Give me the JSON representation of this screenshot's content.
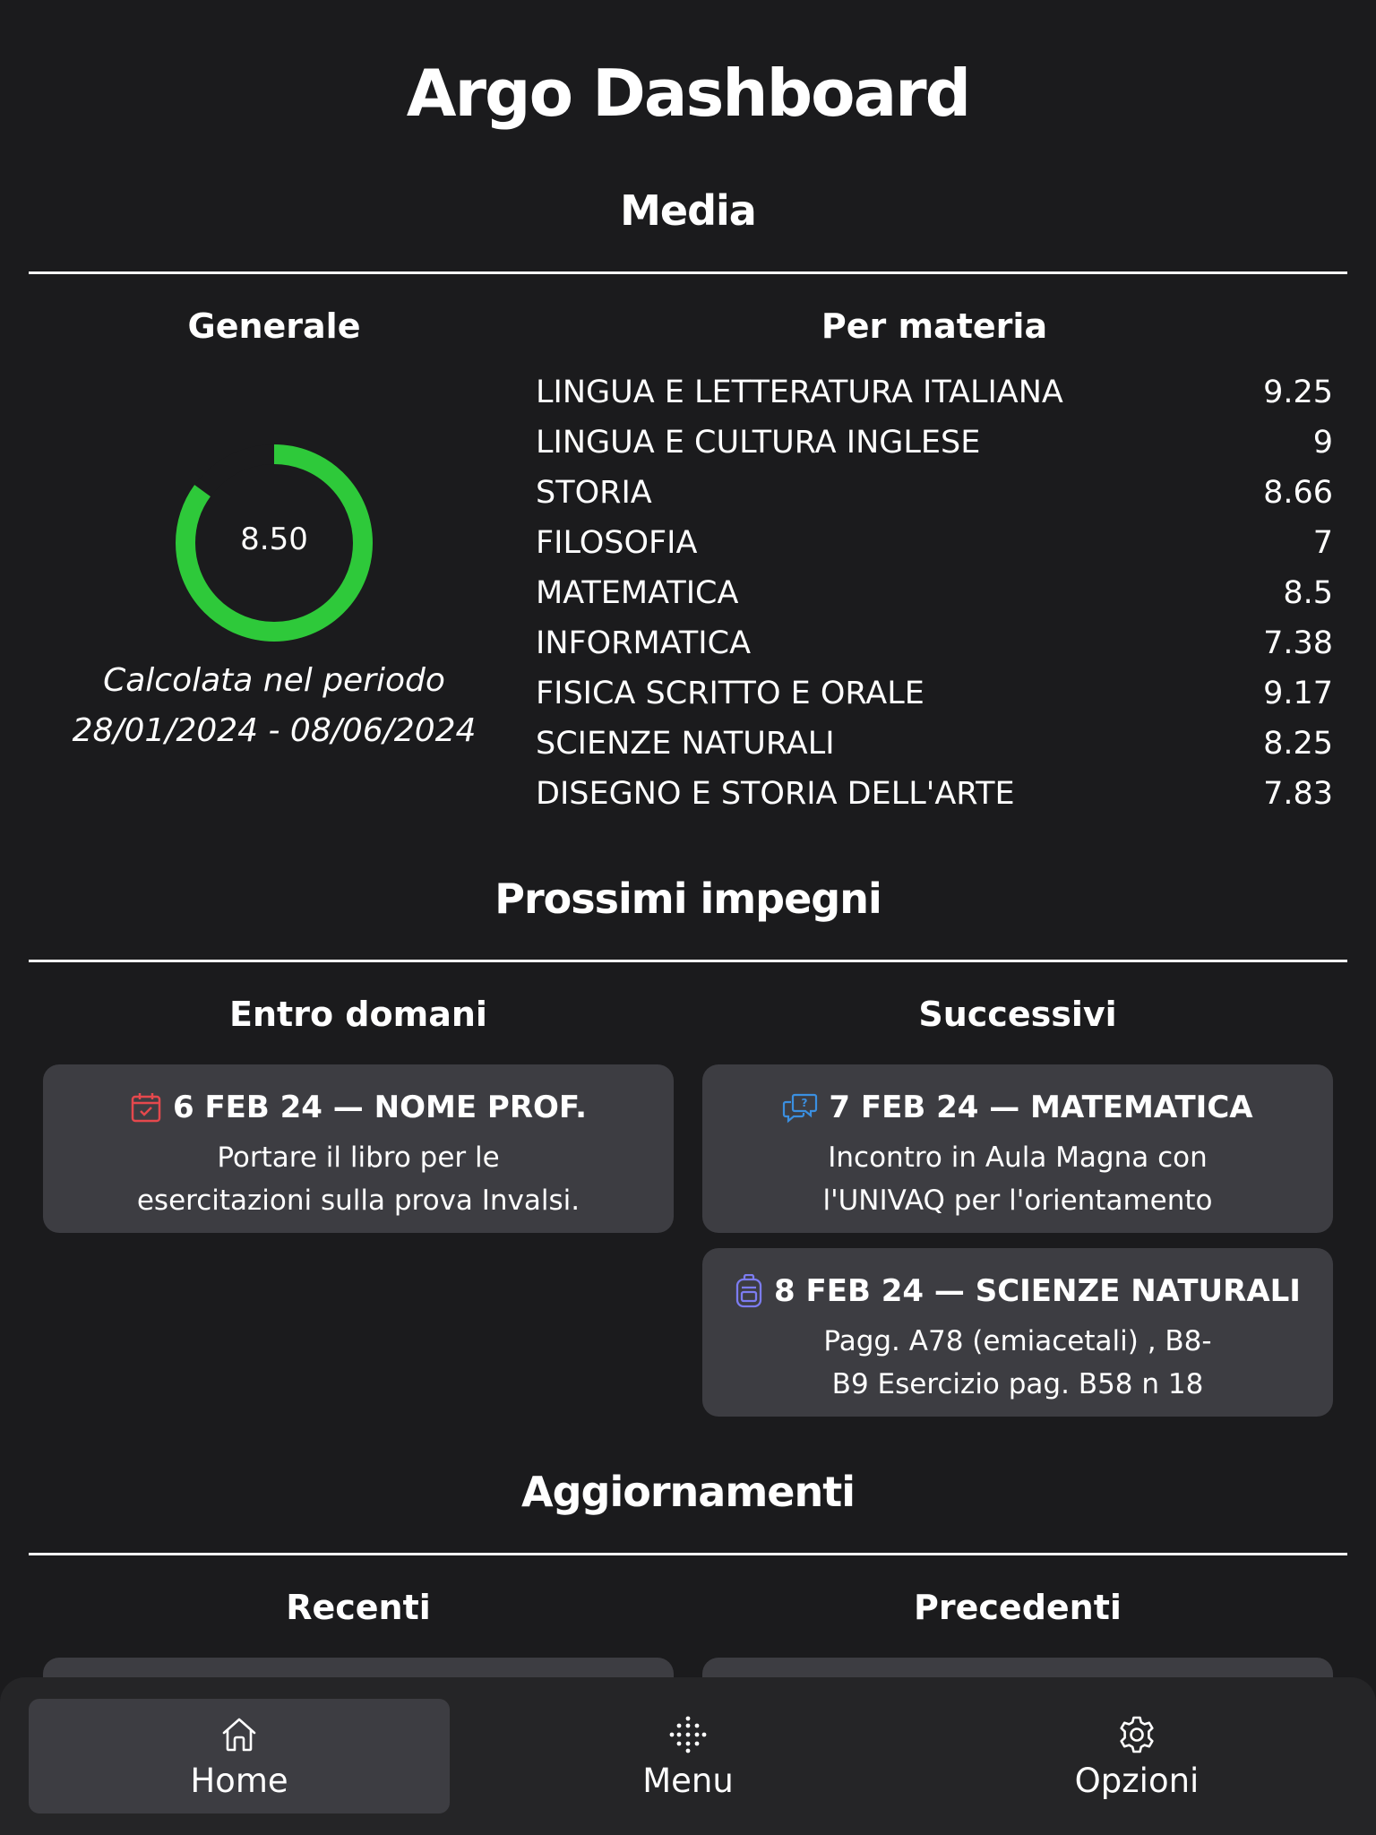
{
  "app": {
    "title": "Argo Dashboard"
  },
  "media": {
    "title": "Media",
    "general_label": "Generale",
    "general_value": "8.50",
    "general_fraction": 0.85,
    "gauge_color": "#2ec93a",
    "period_line1": "Calcolata nel periodo",
    "period_line2": "28/01/2024 - 08/06/2024",
    "per_subject_label": "Per materia",
    "subjects": [
      {
        "name": "LINGUA E LETTERATURA ITALIANA",
        "value": "9.25"
      },
      {
        "name": "LINGUA E CULTURA INGLESE",
        "value": "9"
      },
      {
        "name": "STORIA",
        "value": "8.66"
      },
      {
        "name": "FILOSOFIA",
        "value": "7"
      },
      {
        "name": "MATEMATICA",
        "value": "8.5"
      },
      {
        "name": "INFORMATICA",
        "value": "7.38"
      },
      {
        "name": "FISICA SCRITTO E ORALE",
        "value": "9.17"
      },
      {
        "name": "SCIENZE NATURALI",
        "value": "8.25"
      },
      {
        "name": "DISEGNO E STORIA DELL'ARTE",
        "value": "7.83"
      }
    ]
  },
  "impegni": {
    "title": "Prossimi impegni",
    "entro_label": "Entro domani",
    "successivi_label": "Successivi",
    "entro": [
      {
        "icon": "calendar-check-icon",
        "icon_color": "#e5484d",
        "heading": "6 FEB 24 — NOME PROF.",
        "line1": "Portare il libro per le",
        "line2": "esercitazioni sulla prova Invalsi."
      }
    ],
    "successivi": [
      {
        "icon": "chat-question-icon",
        "icon_color": "#3b8fe0",
        "heading": "7 FEB 24 — MATEMATICA",
        "line1": "Incontro in Aula Magna con",
        "line2": "l'UNIVAQ per l'orientamento"
      },
      {
        "icon": "backpack-icon",
        "icon_color": "#7c7cf0",
        "heading": "8 FEB 24 — SCIENZE NATURALI",
        "line1": "Pagg. A78 (emiacetali) , B8-",
        "line2": "B9 Esercizio pag. B58 n 18"
      }
    ]
  },
  "aggiornamenti": {
    "title": "Aggiornamenti",
    "recenti_label": "Recenti",
    "precedenti_label": "Precedenti"
  },
  "nav": {
    "home": {
      "label": "Home",
      "icon": "home-icon"
    },
    "menu": {
      "label": "Menu",
      "icon": "grid-dots-icon"
    },
    "opzioni": {
      "label": "Opzioni",
      "icon": "gear-icon"
    }
  }
}
